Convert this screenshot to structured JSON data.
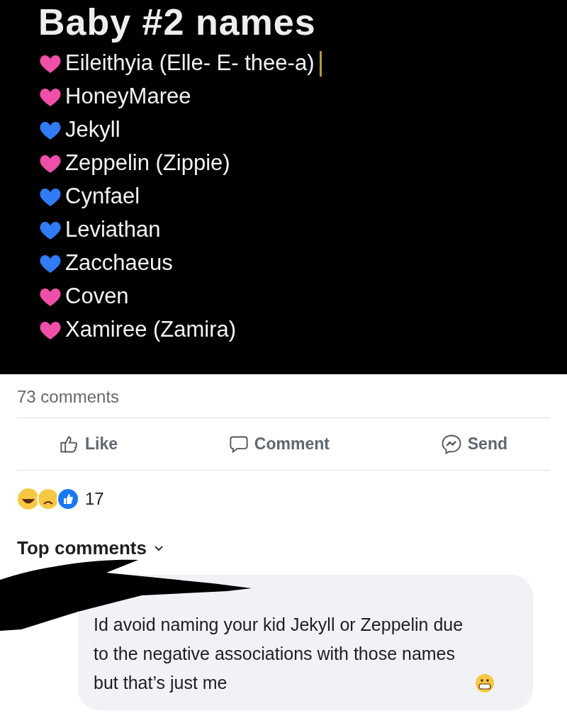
{
  "post": {
    "title": "Baby #2 names",
    "names": [
      {
        "text": "Eileithyia (Elle- E- thee-a)",
        "color": "#f04fa8",
        "cursor": true
      },
      {
        "text": "HoneyMaree",
        "color": "#f04fa8",
        "cursor": false
      },
      {
        "text": "Jekyll",
        "color": "#2f7cf6",
        "cursor": false
      },
      {
        "text": "Zeppelin  (Zippie)",
        "color": "#f04fa8",
        "cursor": false
      },
      {
        "text": "Cynfael",
        "color": "#2f7cf6",
        "cursor": false
      },
      {
        "text": "Leviathan",
        "color": "#2f7cf6",
        "cursor": false
      },
      {
        "text": "Zacchaeus",
        "color": "#2f7cf6",
        "cursor": false
      },
      {
        "text": "Coven",
        "color": "#f04fa8",
        "cursor": false
      },
      {
        "text": "Xamiree (Zamira)",
        "color": "#f04fa8",
        "cursor": false
      }
    ]
  },
  "comment_count": "73 comments",
  "actions": [
    {
      "kind": "like",
      "label": "Like"
    },
    {
      "kind": "comment",
      "label": "Comment"
    },
    {
      "kind": "send",
      "label": "Send"
    }
  ],
  "reactions": {
    "count": "17"
  },
  "sort": {
    "label": "Top comments"
  },
  "comments": [
    {
      "text": "Id avoid naming your kid Jekyll or Zeppelin due to the negative associations with those names but that’s just me"
    }
  ]
}
